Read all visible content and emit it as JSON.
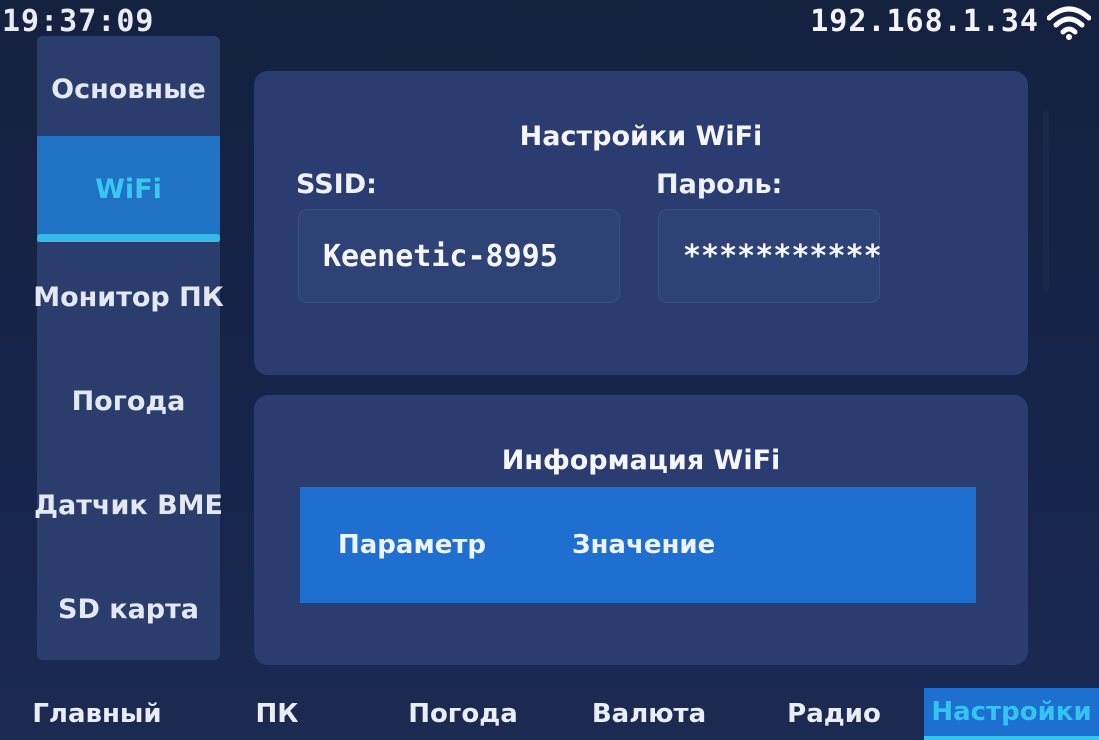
{
  "status": {
    "time": "19:37:09",
    "ip": "192.168.1.34",
    "wifi_icon": "wifi-icon"
  },
  "sidebar": {
    "items": [
      {
        "label": "Основные"
      },
      {
        "label": "WiFi",
        "active": true
      },
      {
        "label": "Монитор ПК"
      },
      {
        "label": "Погода"
      },
      {
        "label": "Датчик BME"
      },
      {
        "label": "SD карта"
      }
    ]
  },
  "settings": {
    "title": "Настройки WiFi",
    "ssid_label": "SSID:",
    "ssid_value": "Keenetic-8995",
    "password_label": "Пароль:",
    "password_value": "***********"
  },
  "info": {
    "title": "Информация WiFi",
    "columns": [
      "Параметр",
      "Значение"
    ]
  },
  "tabs": [
    {
      "label": "Главный"
    },
    {
      "label": "ПК"
    },
    {
      "label": "Погода"
    },
    {
      "label": "Валюта"
    },
    {
      "label": "Радио"
    },
    {
      "label": "Настройки",
      "active": true
    }
  ],
  "colors": {
    "accent": "#1f72c4",
    "accent_text": "#38c8f0",
    "panel": "#2b3d70",
    "background": "#16244a"
  }
}
